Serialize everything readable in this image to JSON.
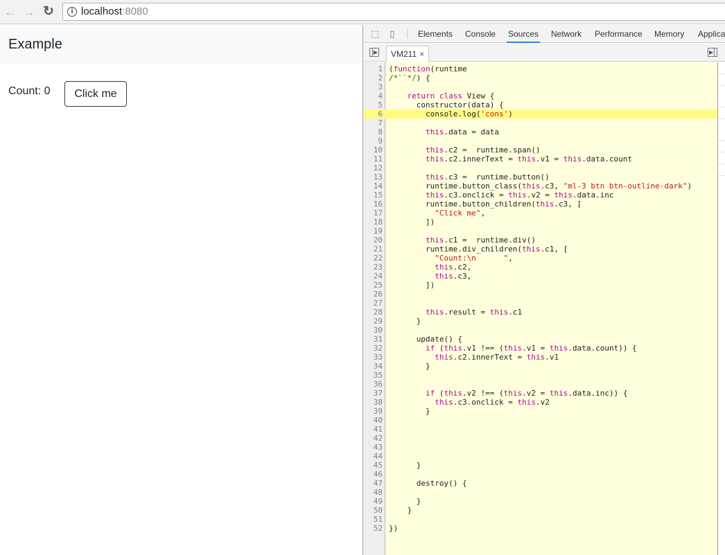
{
  "browser": {
    "url_host": "localhost",
    "url_port": ":8080",
    "icons": {
      "back": "arrow-left-icon",
      "forward": "arrow-right-icon",
      "reload": "reload-icon",
      "info": "info-icon"
    }
  },
  "page": {
    "brand": "Example",
    "count_label": "Count: 0",
    "button_label": "Click me"
  },
  "devtools": {
    "tabs": [
      {
        "label": "Elements",
        "active": false
      },
      {
        "label": "Console",
        "active": false
      },
      {
        "label": "Sources",
        "active": true
      },
      {
        "label": "Network",
        "active": false
      },
      {
        "label": "Performance",
        "active": false
      },
      {
        "label": "Memory",
        "active": false
      },
      {
        "label": "Applicat",
        "active": false
      }
    ],
    "open_file": "VM211",
    "close_glyph": "×",
    "highlighted_line": 6,
    "code_lines": [
      "(function(runtime",
      "/*``*/) {",
      "",
      "    return class View {",
      "      constructor(data) {",
      "        console.log('cons')",
      "",
      "        this.data = data",
      "",
      "        this.c2 =  runtime.span()",
      "        this.c2.innerText = this.v1 = this.data.count",
      "",
      "        this.c3 =  runtime.button()",
      "        runtime.button_class(this.c3, \"ml-3 btn btn-outline-dark\")",
      "        this.c3.onclick = this.v2 = this.data.inc",
      "        runtime.button_children(this.c3, [",
      "          \"Click me\",",
      "        ])",
      "",
      "        this.c1 =  runtime.div()",
      "        runtime.div_children(this.c1, [",
      "          \"Count:\\n      \",",
      "          this.c2,",
      "          this.c3,",
      "        ])",
      "",
      "",
      "        this.result = this.c1",
      "      }",
      "",
      "      update() {",
      "        if (this.v1 !== (this.v1 = this.data.count)) {",
      "          this.c2.innerText = this.v1",
      "        }",
      "",
      "",
      "        if (this.v2 !== (this.v2 = this.data.inc)) {",
      "          this.c3.onclick = this.v2",
      "        }",
      "",
      "",
      "",
      "",
      "",
      "      }",
      "",
      "      destroy() {",
      "",
      "      }",
      "    }",
      "",
      "})"
    ]
  }
}
